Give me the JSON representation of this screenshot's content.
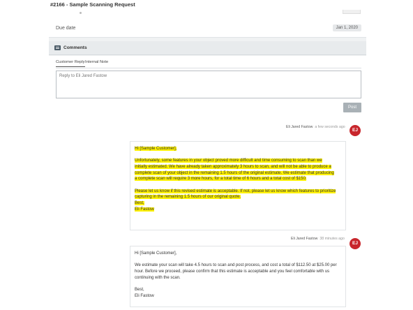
{
  "page": {
    "title": "#2166  -  Sample Scanning Request"
  },
  "details": {
    "due_label": "Due date",
    "due_value": "Jan 1, 2020"
  },
  "comments": {
    "header": "Comments",
    "tabs": [
      {
        "label": "Customer Reply",
        "active": true
      },
      {
        "label": "Internal Note",
        "active": false
      }
    ],
    "reply_placeholder": "Reply to Eli Jared Fastow",
    "post_label": "Post",
    "thread": [
      {
        "author": "Eli Jared Fastow",
        "time": "a few seconds ago",
        "avatar": "EJ",
        "highlighted": true,
        "paragraphs": [
          [
            "Hi [Sample Customer],"
          ],
          [
            "Unfortunately, some features in your object proved more difficult and time consuming to scan than we",
            "initially estimated. We have already taken approximately 3 hours to scan, and will not be able to produce a",
            "complete scan of your object in the remaining 1.5 hours of the original estimate. We estimate that producing",
            "a complete scan will require 3 more hours, for a total time of 6 hours and a total cost of $150."
          ],
          [
            "Please let us know if this revised estimate is acceptable. If not, please let us know which features to prioritize",
            "capturing in the remaining 1.5 hours of our original quote.",
            "Best,",
            "Eli Fastow"
          ]
        ]
      },
      {
        "author": "Eli Jared Fastow",
        "time": "38 minutes ago",
        "avatar": "EJ",
        "highlighted": false,
        "paragraphs": [
          [
            "Hi [Sample Customer],"
          ],
          [
            "We estimate your scan will take 4.5 hours to scan and post process, and cost a total of $112.50 at $25.00 per",
            "hour. Before we proceed, please confirm that this estimate is acceptable and you feel comfortable with us",
            "continuing with the scan."
          ],
          [
            "Best,",
            "Eli Fastow"
          ]
        ]
      }
    ]
  },
  "colors": {
    "highlight": "#fff200",
    "avatar": "#c8262c",
    "post_button": "#a9b1b6"
  }
}
